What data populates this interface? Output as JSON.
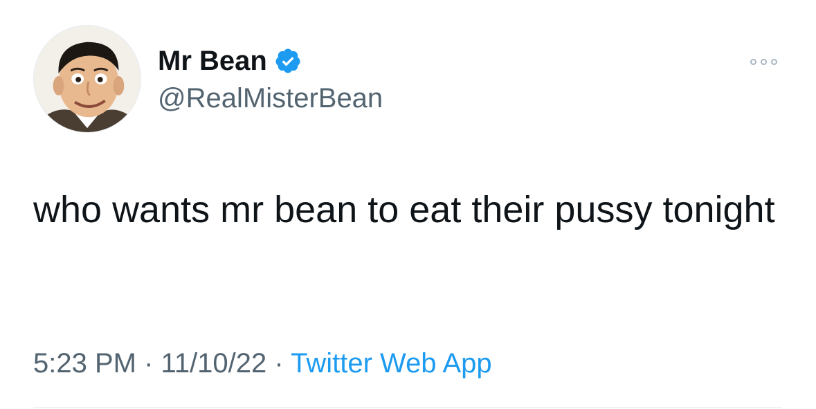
{
  "tweet": {
    "author": {
      "display_name": "Mr Bean",
      "handle": "@RealMisterBean",
      "verified": true,
      "avatar_icon": "profile-photo"
    },
    "more_icon": "more-dots-icon",
    "text": "who wants mr bean to eat their pussy tonight",
    "time": "5:23 PM",
    "separator": "·",
    "date": "11/10/22",
    "source": "Twitter Web App"
  },
  "colors": {
    "text": "#0f1419",
    "secondary": "#536471",
    "accent": "#1d9bf0",
    "divider": "#eff3f4"
  }
}
